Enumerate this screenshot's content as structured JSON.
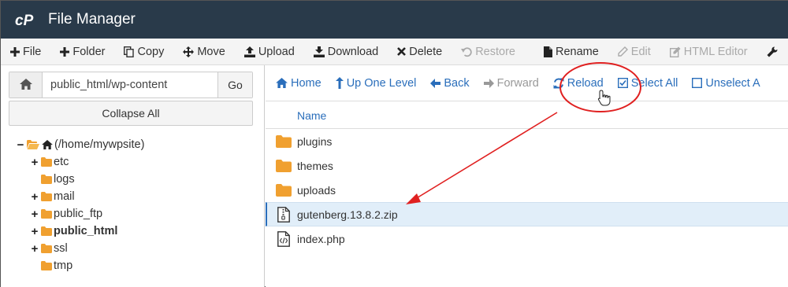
{
  "app": {
    "title": "File Manager"
  },
  "toolbar": [
    {
      "label": "File",
      "icon": "plus-icon",
      "disabled": false
    },
    {
      "label": "Folder",
      "icon": "plus-icon",
      "disabled": false
    },
    {
      "label": "Copy",
      "icon": "copy-icon",
      "disabled": false
    },
    {
      "label": "Move",
      "icon": "move-icon",
      "disabled": false
    },
    {
      "label": "Upload",
      "icon": "upload-icon",
      "disabled": false
    },
    {
      "label": "Download",
      "icon": "download-icon",
      "disabled": false
    },
    {
      "label": "Delete",
      "icon": "close-icon",
      "disabled": false
    },
    {
      "label": "Restore",
      "icon": "undo-icon",
      "disabled": true
    },
    {
      "label": "Rename",
      "icon": "file-icon",
      "disabled": false
    },
    {
      "label": "Edit",
      "icon": "pencil-icon",
      "disabled": true
    },
    {
      "label": "HTML Editor",
      "icon": "edit-box-icon",
      "disabled": true
    }
  ],
  "left": {
    "path_value": "public_html/wp-content",
    "go_label": "Go",
    "collapse_label": "Collapse All",
    "tree": [
      {
        "label": "(/home/mywpsite)",
        "toggle": "−",
        "root": true,
        "bold": false,
        "indent": 0
      },
      {
        "label": "etc",
        "toggle": "+",
        "bold": false,
        "indent": 1
      },
      {
        "label": "logs",
        "toggle": "",
        "bold": false,
        "indent": 1
      },
      {
        "label": "mail",
        "toggle": "+",
        "bold": false,
        "indent": 1
      },
      {
        "label": "public_ftp",
        "toggle": "+",
        "bold": false,
        "indent": 1
      },
      {
        "label": "public_html",
        "toggle": "+",
        "bold": true,
        "indent": 1
      },
      {
        "label": "ssl",
        "toggle": "+",
        "bold": false,
        "indent": 1
      },
      {
        "label": "tmp",
        "toggle": "",
        "bold": false,
        "indent": 1
      }
    ]
  },
  "nav": [
    {
      "label": "Home",
      "icon": "home-icon",
      "disabled": false
    },
    {
      "label": "Up One Level",
      "icon": "arrow-up-icon",
      "disabled": false
    },
    {
      "label": "Back",
      "icon": "arrow-left-icon",
      "disabled": false
    },
    {
      "label": "Forward",
      "icon": "arrow-right-icon",
      "disabled": true
    },
    {
      "label": "Reload",
      "icon": "refresh-icon",
      "disabled": false
    },
    {
      "label": "Select All",
      "icon": "checkbox-checked-icon",
      "disabled": false
    },
    {
      "label": "Unselect A",
      "icon": "checkbox-empty-icon",
      "disabled": false
    }
  ],
  "table": {
    "header_name": "Name",
    "rows": [
      {
        "name": "plugins",
        "type": "folder",
        "selected": false
      },
      {
        "name": "themes",
        "type": "folder",
        "selected": false
      },
      {
        "name": "uploads",
        "type": "folder",
        "selected": false
      },
      {
        "name": "gutenberg.13.8.2.zip",
        "type": "zip",
        "selected": true
      },
      {
        "name": "index.php",
        "type": "code",
        "selected": false
      }
    ]
  },
  "colors": {
    "header_bg": "#293a4a",
    "link": "#2a6ebb",
    "folder": "#f0a030",
    "annotation": "#e02020"
  }
}
